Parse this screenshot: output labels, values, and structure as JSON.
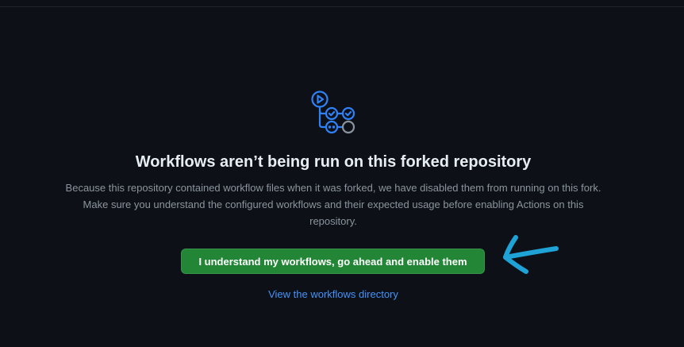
{
  "empty_state": {
    "icon": "workflow-icon",
    "title": "Workflows aren’t being run on this forked repository",
    "description": "Because this repository contained workflow files when it was forked, we have disabled them from running on this fork. Make sure you understand the configured workflows and their expected usage before enabling Actions on this repository.",
    "enable_button_label": "I understand my workflows, go ahead and enable them",
    "directory_link_label": "View the workflows directory"
  },
  "annotation": {
    "icon": "arrow-icon",
    "color": "#1fa3d6"
  },
  "colors": {
    "background": "#0d1117",
    "primary_button": "#238636",
    "link": "#4493f8",
    "icon_accent": "#2f81f7"
  }
}
